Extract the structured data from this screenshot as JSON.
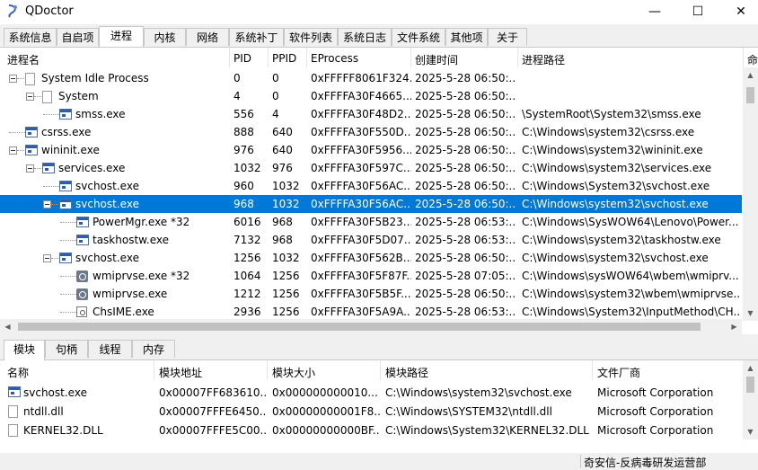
{
  "window": {
    "title": "QDoctor",
    "minimize": "—",
    "maximize": "☐",
    "close": "✕"
  },
  "top_tabs": [
    "系统信息",
    "自启项",
    "进程",
    "内核",
    "网络",
    "系统补丁",
    "软件列表",
    "系统日志",
    "文件系统",
    "其他项",
    "关于"
  ],
  "top_tabs_active": 2,
  "process_columns": [
    "进程名",
    "PID",
    "PPID",
    "EProcess",
    "创建时间",
    "进程路径",
    "命"
  ],
  "processes": [
    {
      "name": "System Idle Process",
      "pid": "0",
      "ppid": "0",
      "eprocess": "0xFFFFF8061F324...",
      "time": "2025-5-28 06:50:...",
      "path": "",
      "depth": 0,
      "icon": "doc",
      "expander": true
    },
    {
      "name": "System",
      "pid": "4",
      "ppid": "0",
      "eprocess": "0xFFFFA30F4665...",
      "time": "2025-5-28 06:50:...",
      "path": "",
      "depth": 1,
      "icon": "doc",
      "expander": true
    },
    {
      "name": "smss.exe",
      "pid": "556",
      "ppid": "4",
      "eprocess": "0xFFFFA30F48D2...",
      "time": "2025-5-28 06:50:...",
      "path": "\\SystemRoot\\System32\\smss.exe",
      "depth": 2,
      "icon": "win",
      "expander": false
    },
    {
      "name": "csrss.exe",
      "pid": "888",
      "ppid": "640",
      "eprocess": "0xFFFFA30F550D...",
      "time": "2025-5-28 06:50:...",
      "path": "C:\\Windows\\system32\\csrss.exe",
      "depth": 0,
      "icon": "win",
      "expander": false
    },
    {
      "name": "wininit.exe",
      "pid": "976",
      "ppid": "640",
      "eprocess": "0xFFFFA30F5956...",
      "time": "2025-5-28 06:50:...",
      "path": "C:\\Windows\\system32\\wininit.exe",
      "depth": 0,
      "icon": "win",
      "expander": true
    },
    {
      "name": "services.exe",
      "pid": "1032",
      "ppid": "976",
      "eprocess": "0xFFFFA30F597C...",
      "time": "2025-5-28 06:50:...",
      "path": "C:\\Windows\\system32\\services.exe",
      "depth": 1,
      "icon": "win",
      "expander": true
    },
    {
      "name": "svchost.exe",
      "pid": "960",
      "ppid": "1032",
      "eprocess": "0xFFFFA30F56AC...",
      "time": "2025-5-28 06:50:...",
      "path": "C:\\Windows\\System32\\svchost.exe",
      "depth": 2,
      "icon": "win",
      "expander": false
    },
    {
      "name": "svchost.exe",
      "pid": "968",
      "ppid": "1032",
      "eprocess": "0xFFFFA30F56AC...",
      "time": "2025-5-28 06:50:...",
      "path": "C:\\Windows\\system32\\svchost.exe",
      "depth": 2,
      "icon": "win",
      "expander": true,
      "selected": true
    },
    {
      "name": "PowerMgr.exe *32",
      "pid": "6016",
      "ppid": "968",
      "eprocess": "0xFFFFA30F5B23...",
      "time": "2025-5-28 06:53:...",
      "path": "C:\\Windows\\SysWOW64\\Lenovo\\Power...",
      "depth": 3,
      "icon": "win",
      "expander": false
    },
    {
      "name": "taskhostw.exe",
      "pid": "7132",
      "ppid": "968",
      "eprocess": "0xFFFFA30F5D07...",
      "time": "2025-5-28 06:53:...",
      "path": "C:\\Windows\\system32\\taskhostw.exe",
      "depth": 3,
      "icon": "win",
      "expander": false
    },
    {
      "name": "svchost.exe",
      "pid": "1256",
      "ppid": "1032",
      "eprocess": "0xFFFFA30F562B...",
      "time": "2025-5-28 06:50:...",
      "path": "C:\\Windows\\system32\\svchost.exe",
      "depth": 2,
      "icon": "win",
      "expander": true
    },
    {
      "name": "wmiprvse.exe *32",
      "pid": "1064",
      "ppid": "1256",
      "eprocess": "0xFFFFA30F5F87F...",
      "time": "2025-5-28 07:05:...",
      "path": "C:\\Windows\\sysWOW64\\wbem\\wmiprv...",
      "depth": 3,
      "icon": "svc",
      "expander": false
    },
    {
      "name": "wmiprvse.exe",
      "pid": "1212",
      "ppid": "1256",
      "eprocess": "0xFFFFA30F5B5F...",
      "time": "2025-5-28 06:50:...",
      "path": "C:\\Windows\\system32\\wbem\\wmiprvse...",
      "depth": 3,
      "icon": "svc",
      "expander": false
    },
    {
      "name": "ChsIME.exe",
      "pid": "2936",
      "ppid": "1256",
      "eprocess": "0xFFFFA30F5A9A...",
      "time": "2025-5-28 06:53:...",
      "path": "C:\\Windows\\System32\\InputMethod\\CH...",
      "depth": 3,
      "icon": "ime",
      "expander": false
    }
  ],
  "bottom_tabs": [
    "模块",
    "句柄",
    "线程",
    "内存"
  ],
  "bottom_tabs_active": 0,
  "module_columns": [
    "名称",
    "模块地址",
    "模块大小",
    "模块路径",
    "文件厂商"
  ],
  "modules": [
    {
      "name": "svchost.exe",
      "addr": "0x00007FF683610...",
      "size": "0x000000000010...",
      "path": "C:\\Windows\\system32\\svchost.exe",
      "vendor": "Microsoft Corporation",
      "icon": "win"
    },
    {
      "name": "ntdll.dll",
      "addr": "0x00007FFFE6450...",
      "size": "0x00000000001F8...",
      "path": "C:\\Windows\\SYSTEM32\\ntdll.dll",
      "vendor": "Microsoft Corporation",
      "icon": "doc"
    },
    {
      "name": "KERNEL32.DLL",
      "addr": "0x00007FFFE5C00...",
      "size": "0x00000000000BF...",
      "path": "C:\\Windows\\System32\\KERNEL32.DLL",
      "vendor": "Microsoft Corporation",
      "icon": "doc"
    }
  ],
  "status": {
    "text": "奇安信-反病毒研发运营部"
  },
  "colors": {
    "selection": "#0078d7",
    "selection_text": "#ffffff"
  }
}
